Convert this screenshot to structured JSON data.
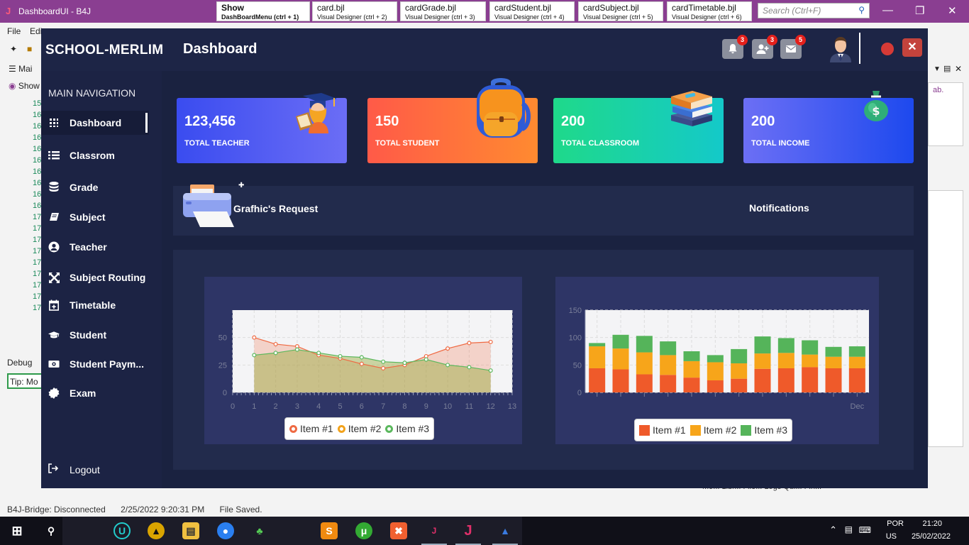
{
  "ide": {
    "window_title": "DashboardUI - B4J",
    "tabs": [
      {
        "name": "Show",
        "desc": "DashBoardMenu  (ctrl + 1)"
      },
      {
        "name": "card.bjl",
        "desc": "Visual Designer  (ctrl + 2)"
      },
      {
        "name": "cardGrade.bjl",
        "desc": "Visual Designer  (ctrl + 3)"
      },
      {
        "name": "cardStudent.bjl",
        "desc": "Visual Designer  (ctrl + 4)"
      },
      {
        "name": "cardSubject.bjl",
        "desc": "Visual Designer  (ctrl + 5)"
      },
      {
        "name": "cardTimetable.bjl",
        "desc": "Visual Designer  (ctrl + 6)"
      }
    ],
    "search_placeholder": "Search (Ctrl+F)",
    "menu": [
      "File",
      "Edi"
    ],
    "toolbar_main": "Mai",
    "toolbar_show": "Show",
    "line_numbers": [
      "15",
      "16",
      "16",
      "16",
      "16",
      "16",
      "16",
      "16",
      "16",
      "16",
      "17",
      "17",
      "17",
      "17",
      "17",
      "17",
      "17",
      "17",
      "17"
    ],
    "debug_label": "Debug",
    "tip_text": "Tip: Mo",
    "right_text": "ab.",
    "bottom_tabs": "Mo...   Libr...   File...   Logs   Qui...        Fin...",
    "status": {
      "bridge": "B4J-Bridge: Disconnected",
      "time": "2/25/2022 9:20:31 PM",
      "message": "File Saved."
    }
  },
  "taskbar": {
    "lang": "POR",
    "region": "US",
    "clock_time": "21:20",
    "clock_date": "25/02/2022"
  },
  "app": {
    "brand": "SCHOOL-MERLIM",
    "page_title": "Dashboard",
    "header_badges": {
      "notifications": "3",
      "users": "3",
      "messages": "5"
    },
    "nav_heading": "MAIN NAVIGATION",
    "nav": [
      {
        "label": "Dashboard",
        "icon": "grid-icon"
      },
      {
        "label": "Classrom",
        "icon": "list-icon"
      },
      {
        "label": "Grade",
        "icon": "database-icon"
      },
      {
        "label": "Subject",
        "icon": "book-icon"
      },
      {
        "label": "Teacher",
        "icon": "user-circle-icon"
      },
      {
        "label": "Subject Routing",
        "icon": "expand-arrows-icon"
      },
      {
        "label": "Timetable",
        "icon": "calendar-plus-icon"
      },
      {
        "label": "Student",
        "icon": "graduation-cap-icon"
      },
      {
        "label": "Student Paym...",
        "icon": "money-bill-icon"
      },
      {
        "label": "Exam",
        "icon": "certificate-icon"
      }
    ],
    "logout": "Logout",
    "cards": [
      {
        "value": "123,456",
        "label": "TOTAL TEACHER",
        "color_from": "#3a4cf0",
        "color_to": "#6b6df5",
        "art": "teacher-graduate-icon"
      },
      {
        "value": "150",
        "label": "TOTAL STUDENT",
        "color_from": "#ff5a48",
        "color_to": "#ff8a30",
        "art": "backpack-icon"
      },
      {
        "value": "200",
        "label": "TOTAL CLASSROOM",
        "color_from": "#1fd98a",
        "color_to": "#14c9c9",
        "art": "books-stack-icon"
      },
      {
        "value": "200",
        "label": "TOTAL INCOME",
        "color_from": "#6c6ff5",
        "color_to": "#1d49ee",
        "art": "money-bag-icon"
      }
    ],
    "requests_title": "Grafhic's Request",
    "notifications_title": "Notifications"
  },
  "chart_data": [
    {
      "type": "area",
      "x": [
        1,
        2,
        3,
        4,
        5,
        6,
        7,
        8,
        9,
        10,
        11,
        12
      ],
      "xlim": [
        0,
        13
      ],
      "ylim": [
        0,
        75
      ],
      "y_ticks": [
        0,
        25,
        50
      ],
      "x_ticks": [
        0,
        1,
        2,
        3,
        4,
        5,
        6,
        7,
        8,
        9,
        10,
        11,
        12,
        13
      ],
      "series": [
        {
          "name": "Item #1",
          "color": "#ef6a43",
          "values": [
            50,
            44,
            42,
            34,
            31,
            26,
            22,
            25,
            33,
            40,
            45,
            46
          ]
        },
        {
          "name": "Item #2",
          "color": "#f2a21b",
          "values": []
        },
        {
          "name": "Item #3",
          "color": "#5bb85d",
          "values": [
            34,
            36,
            39,
            36,
            33,
            32,
            28,
            27,
            30,
            25,
            23,
            20
          ]
        }
      ],
      "grid": true,
      "legend": "bottom"
    },
    {
      "type": "bar",
      "stacked": true,
      "categories": [
        "",
        "",
        "",
        "",
        "",
        "",
        "",
        "",
        "",
        "",
        "",
        "Dec"
      ],
      "ylim": [
        0,
        150
      ],
      "y_ticks": [
        0,
        50,
        100,
        150
      ],
      "series": [
        {
          "name": "Item #1",
          "color": "#ef5a2a",
          "values": [
            44,
            42,
            33,
            32,
            27,
            22,
            25,
            43,
            44,
            46,
            44,
            44
          ]
        },
        {
          "name": "Item #2",
          "color": "#f7a51a",
          "values": [
            40,
            38,
            40,
            36,
            30,
            33,
            28,
            28,
            28,
            23,
            21,
            21
          ]
        },
        {
          "name": "Item #3",
          "color": "#55b45a",
          "values": [
            6,
            25,
            30,
            25,
            18,
            13,
            26,
            31,
            27,
            26,
            18,
            19
          ]
        }
      ],
      "grid": true,
      "legend": "bottom"
    }
  ]
}
